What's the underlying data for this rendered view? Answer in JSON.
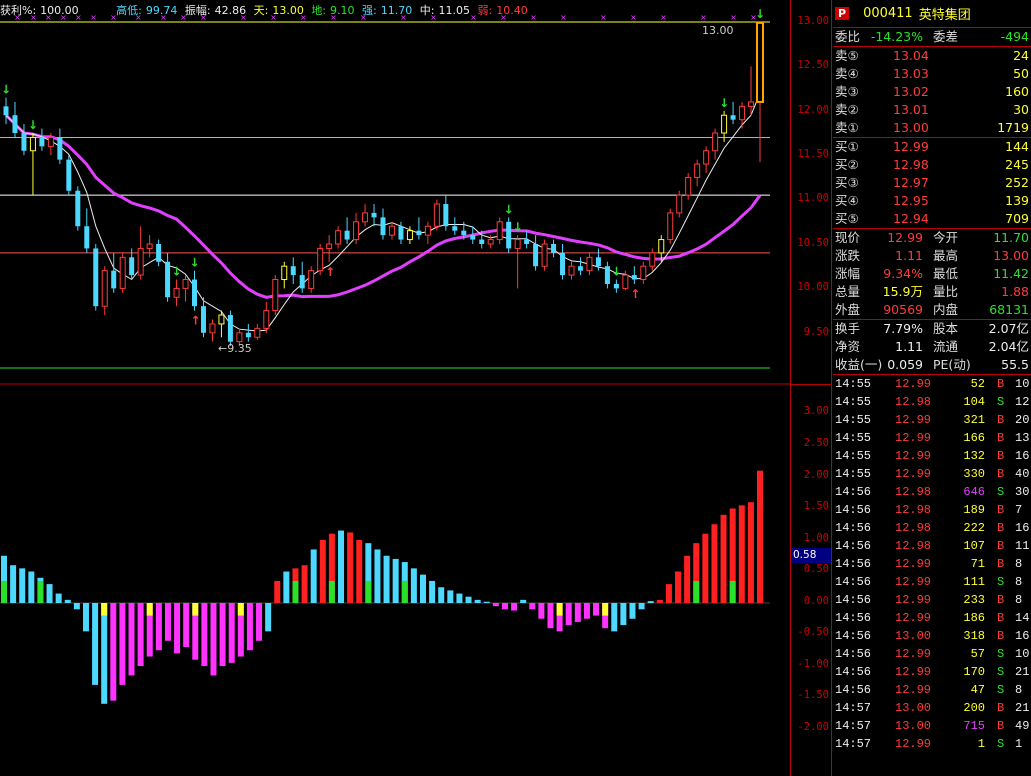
{
  "topbar": {
    "profit_label": "获利%:",
    "profit_value": "100.00",
    "highlow_label": "高低:",
    "highlow_value": "99.74",
    "amp_label": "振幅:",
    "amp_value": "42.86",
    "tian_label": "天:",
    "tian_value": "13.00",
    "di_label": "地:",
    "di_value": "9.10",
    "qiang_label": "强:",
    "qiang_value": "11.70",
    "zhong_label": "中:",
    "zhong_value": "11.05",
    "ruo_label": "弱:",
    "ruo_value": "10.40"
  },
  "price_axis": [
    "13.00",
    "12.50",
    "12.00",
    "11.50",
    "11.00",
    "10.50",
    "10.00",
    "9.50"
  ],
  "osc_axis": [
    "3.00",
    "2.50",
    "2.00",
    "1.50",
    "1.00",
    "0.50",
    "0.00",
    "-0.50",
    "-1.00",
    "-1.50",
    "-2.00"
  ],
  "osc_current": "0.58",
  "annotations": {
    "high": "13.00",
    "low": "←9.35"
  },
  "stock": {
    "badge": "P",
    "code": "000411",
    "name": "英特集团"
  },
  "weibi": {
    "label": "委比",
    "value": "-14.23%",
    "label2": "委差",
    "value2": "-494"
  },
  "asks": [
    {
      "label": "卖⑤",
      "price": "13.04",
      "vol": "24"
    },
    {
      "label": "卖④",
      "price": "13.03",
      "vol": "50"
    },
    {
      "label": "卖③",
      "price": "13.02",
      "vol": "160"
    },
    {
      "label": "卖②",
      "price": "13.01",
      "vol": "30"
    },
    {
      "label": "卖①",
      "price": "13.00",
      "vol": "1719"
    }
  ],
  "bids": [
    {
      "label": "买①",
      "price": "12.99",
      "vol": "144"
    },
    {
      "label": "买②",
      "price": "12.98",
      "vol": "245"
    },
    {
      "label": "买③",
      "price": "12.97",
      "vol": "252"
    },
    {
      "label": "买④",
      "price": "12.95",
      "vol": "139"
    },
    {
      "label": "买⑤",
      "price": "12.94",
      "vol": "709"
    }
  ],
  "quote": [
    {
      "l1": "现价",
      "v1": "12.99",
      "l2": "今开",
      "v2": "11.70"
    },
    {
      "l1": "涨跌",
      "v1": "1.11",
      "l2": "最高",
      "v2": "13.00"
    },
    {
      "l1": "涨幅",
      "v1": "9.34%",
      "l2": "最低",
      "v2": "11.42"
    },
    {
      "l1": "总量",
      "v1": "15.9万",
      "l2": "量比",
      "v2": "1.88"
    },
    {
      "l1": "外盘",
      "v1": "90569",
      "l2": "内盘",
      "v2": "68131"
    }
  ],
  "fundamentals": [
    {
      "l1": "换手",
      "v1": "7.79%",
      "l2": "股本",
      "v2": "2.07亿"
    },
    {
      "l1": "净资",
      "v1": "1.11",
      "l2": "流通",
      "v2": "2.04亿"
    },
    {
      "l1": "收益(一)",
      "v1": "0.059",
      "l2": "PE(动)",
      "v2": "55.5"
    }
  ],
  "ticks": [
    {
      "time": "14:55",
      "price": "12.99",
      "vol": "52",
      "side": "B",
      "num": "10"
    },
    {
      "time": "14:55",
      "price": "12.98",
      "vol": "104",
      "side": "S",
      "num": "12"
    },
    {
      "time": "14:55",
      "price": "12.99",
      "vol": "321",
      "side": "B",
      "num": "20"
    },
    {
      "time": "14:55",
      "price": "12.99",
      "vol": "166",
      "side": "B",
      "num": "13"
    },
    {
      "time": "14:55",
      "price": "12.99",
      "vol": "132",
      "side": "B",
      "num": "16"
    },
    {
      "time": "14:55",
      "price": "12.99",
      "vol": "330",
      "side": "B",
      "num": "40"
    },
    {
      "time": "14:56",
      "price": "12.98",
      "vol": "646",
      "side": "S",
      "num": "30"
    },
    {
      "time": "14:56",
      "price": "12.98",
      "vol": "189",
      "side": "B",
      "num": "7"
    },
    {
      "time": "14:56",
      "price": "12.98",
      "vol": "222",
      "side": "B",
      "num": "16"
    },
    {
      "time": "14:56",
      "price": "12.98",
      "vol": "107",
      "side": "B",
      "num": "11"
    },
    {
      "time": "14:56",
      "price": "12.99",
      "vol": "71",
      "side": "B",
      "num": "8"
    },
    {
      "time": "14:56",
      "price": "12.99",
      "vol": "111",
      "side": "S",
      "num": "8"
    },
    {
      "time": "14:56",
      "price": "12.99",
      "vol": "233",
      "side": "B",
      "num": "8"
    },
    {
      "time": "14:56",
      "price": "12.99",
      "vol": "186",
      "side": "B",
      "num": "14"
    },
    {
      "time": "14:56",
      "price": "13.00",
      "vol": "318",
      "side": "B",
      "num": "16"
    },
    {
      "time": "14:56",
      "price": "12.99",
      "vol": "57",
      "side": "S",
      "num": "10"
    },
    {
      "time": "14:56",
      "price": "12.99",
      "vol": "170",
      "side": "S",
      "num": "21"
    },
    {
      "time": "14:56",
      "price": "12.99",
      "vol": "47",
      "side": "S",
      "num": "8"
    },
    {
      "time": "14:57",
      "price": "13.00",
      "vol": "200",
      "side": "B",
      "num": "21"
    },
    {
      "time": "14:57",
      "price": "13.00",
      "vol": "715",
      "side": "B",
      "num": "49"
    },
    {
      "time": "14:57",
      "price": "12.99",
      "vol": "1",
      "side": "S",
      "num": "1"
    }
  ],
  "colors": {
    "up": "#ff3b3b",
    "down": "#4cd8ff",
    "ma": "#e040fb",
    "axis": "#cc0000",
    "green_line": "#2be02b",
    "buy_arrow": "#ff3b3b",
    "sell_arrow": "#2be02b"
  },
  "candles": [
    [
      12.05,
      12.15,
      11.85,
      11.95
    ],
    [
      11.95,
      12.1,
      11.7,
      11.75
    ],
    [
      11.75,
      11.85,
      11.5,
      11.55
    ],
    [
      11.55,
      11.75,
      11.05,
      11.7
    ],
    [
      11.7,
      11.8,
      11.55,
      11.6
    ],
    [
      11.6,
      11.75,
      11.5,
      11.7
    ],
    [
      11.7,
      11.8,
      11.4,
      11.45
    ],
    [
      11.45,
      11.5,
      11.05,
      11.1
    ],
    [
      11.1,
      11.15,
      10.65,
      10.7
    ],
    [
      10.7,
      10.9,
      10.4,
      10.45
    ],
    [
      10.45,
      10.5,
      9.75,
      9.8
    ],
    [
      9.8,
      10.25,
      9.7,
      10.2
    ],
    [
      10.2,
      10.4,
      9.95,
      10.0
    ],
    [
      10.0,
      10.4,
      9.95,
      10.35
    ],
    [
      10.35,
      10.45,
      10.1,
      10.15
    ],
    [
      10.15,
      10.7,
      10.1,
      10.45
    ],
    [
      10.45,
      10.6,
      10.35,
      10.5
    ],
    [
      10.5,
      10.55,
      10.25,
      10.3
    ],
    [
      10.3,
      10.4,
      9.85,
      9.9
    ],
    [
      9.9,
      10.1,
      9.8,
      10.0
    ],
    [
      10.0,
      10.15,
      9.85,
      10.1
    ],
    [
      10.1,
      10.2,
      9.75,
      9.8
    ],
    [
      9.8,
      9.9,
      9.45,
      9.5
    ],
    [
      9.5,
      9.65,
      9.4,
      9.6
    ],
    [
      9.6,
      9.75,
      9.45,
      9.7
    ],
    [
      9.7,
      9.75,
      9.35,
      9.4
    ],
    [
      9.4,
      9.55,
      9.35,
      9.5
    ],
    [
      9.5,
      9.6,
      9.4,
      9.45
    ],
    [
      9.45,
      9.6,
      9.42,
      9.55
    ],
    [
      9.55,
      9.85,
      9.5,
      9.75
    ],
    [
      9.75,
      10.15,
      9.7,
      10.1
    ],
    [
      10.1,
      10.3,
      10.0,
      10.25
    ],
    [
      10.25,
      10.35,
      10.05,
      10.15
    ],
    [
      10.15,
      10.3,
      9.95,
      10.0
    ],
    [
      10.0,
      10.25,
      9.95,
      10.2
    ],
    [
      10.2,
      10.5,
      10.15,
      10.45
    ],
    [
      10.45,
      10.6,
      10.3,
      10.5
    ],
    [
      10.5,
      10.7,
      10.45,
      10.65
    ],
    [
      10.65,
      10.8,
      10.5,
      10.55
    ],
    [
      10.55,
      10.85,
      10.5,
      10.75
    ],
    [
      10.75,
      10.95,
      10.7,
      10.85
    ],
    [
      10.85,
      10.95,
      10.7,
      10.8
    ],
    [
      10.8,
      10.9,
      10.55,
      10.6
    ],
    [
      10.6,
      10.75,
      10.55,
      10.7
    ],
    [
      10.7,
      10.75,
      10.5,
      10.55
    ],
    [
      10.55,
      10.7,
      10.5,
      10.65
    ],
    [
      10.65,
      10.8,
      10.55,
      10.6
    ],
    [
      10.6,
      10.75,
      10.5,
      10.7
    ],
    [
      10.7,
      11.0,
      10.65,
      10.95
    ],
    [
      10.95,
      11.05,
      10.65,
      10.7
    ],
    [
      10.7,
      10.8,
      10.6,
      10.65
    ],
    [
      10.65,
      10.75,
      10.55,
      10.6
    ],
    [
      10.6,
      10.7,
      10.5,
      10.55
    ],
    [
      10.55,
      10.65,
      10.45,
      10.5
    ],
    [
      10.5,
      10.6,
      10.45,
      10.55
    ],
    [
      10.55,
      10.8,
      10.5,
      10.75
    ],
    [
      10.75,
      10.8,
      10.4,
      10.45
    ],
    [
      10.45,
      10.6,
      10.0,
      10.55
    ],
    [
      10.55,
      10.65,
      10.45,
      10.5
    ],
    [
      10.5,
      10.6,
      10.2,
      10.25
    ],
    [
      10.25,
      10.55,
      10.2,
      10.5
    ],
    [
      10.5,
      10.55,
      10.35,
      10.4
    ],
    [
      10.4,
      10.5,
      10.1,
      10.15
    ],
    [
      10.15,
      10.3,
      10.1,
      10.25
    ],
    [
      10.25,
      10.35,
      10.15,
      10.2
    ],
    [
      10.2,
      10.4,
      10.15,
      10.35
    ],
    [
      10.35,
      10.45,
      10.2,
      10.25
    ],
    [
      10.25,
      10.3,
      10.0,
      10.05
    ],
    [
      10.05,
      10.1,
      9.95,
      10.0
    ],
    [
      10.0,
      10.2,
      9.98,
      10.15
    ],
    [
      10.15,
      10.25,
      10.05,
      10.1
    ],
    [
      10.1,
      10.3,
      10.05,
      10.25
    ],
    [
      10.25,
      10.45,
      10.2,
      10.4
    ],
    [
      10.4,
      10.6,
      10.3,
      10.55
    ],
    [
      10.55,
      10.9,
      10.5,
      10.85
    ],
    [
      10.85,
      11.1,
      10.8,
      11.05
    ],
    [
      11.05,
      11.3,
      11.0,
      11.25
    ],
    [
      11.25,
      11.45,
      11.15,
      11.4
    ],
    [
      11.4,
      11.6,
      11.3,
      11.55
    ],
    [
      11.55,
      11.8,
      11.45,
      11.75
    ],
    [
      11.75,
      12.0,
      11.65,
      11.95
    ],
    [
      11.95,
      12.1,
      11.85,
      11.9
    ],
    [
      11.9,
      12.1,
      11.8,
      12.05
    ],
    [
      12.05,
      12.5,
      11.95,
      12.1
    ],
    [
      12.1,
      13.0,
      11.42,
      12.99
    ]
  ],
  "osc": [
    0.75,
    0.6,
    0.55,
    0.5,
    0.4,
    0.3,
    0.15,
    0.05,
    -0.1,
    -0.45,
    -1.3,
    -1.6,
    -1.55,
    -1.3,
    -1.15,
    -1.0,
    -0.85,
    -0.75,
    -0.6,
    -0.8,
    -0.7,
    -0.9,
    -1.0,
    -1.15,
    -1.0,
    -0.95,
    -0.85,
    -0.75,
    -0.6,
    -0.45,
    0.35,
    0.5,
    0.55,
    0.6,
    0.85,
    1.0,
    1.1,
    1.15,
    1.12,
    1.0,
    0.95,
    0.85,
    0.75,
    0.7,
    0.65,
    0.55,
    0.45,
    0.35,
    0.25,
    0.2,
    0.15,
    0.1,
    0.05,
    0.02,
    -0.05,
    -0.1,
    -0.12,
    0.05,
    -0.1,
    -0.25,
    -0.4,
    -0.45,
    -0.35,
    -0.3,
    -0.25,
    -0.2,
    -0.4,
    -0.45,
    -0.35,
    -0.25,
    -0.1,
    0.03,
    0.05,
    0.3,
    0.5,
    0.75,
    0.95,
    1.1,
    1.25,
    1.4,
    1.5,
    1.55,
    1.6,
    2.1
  ]
}
